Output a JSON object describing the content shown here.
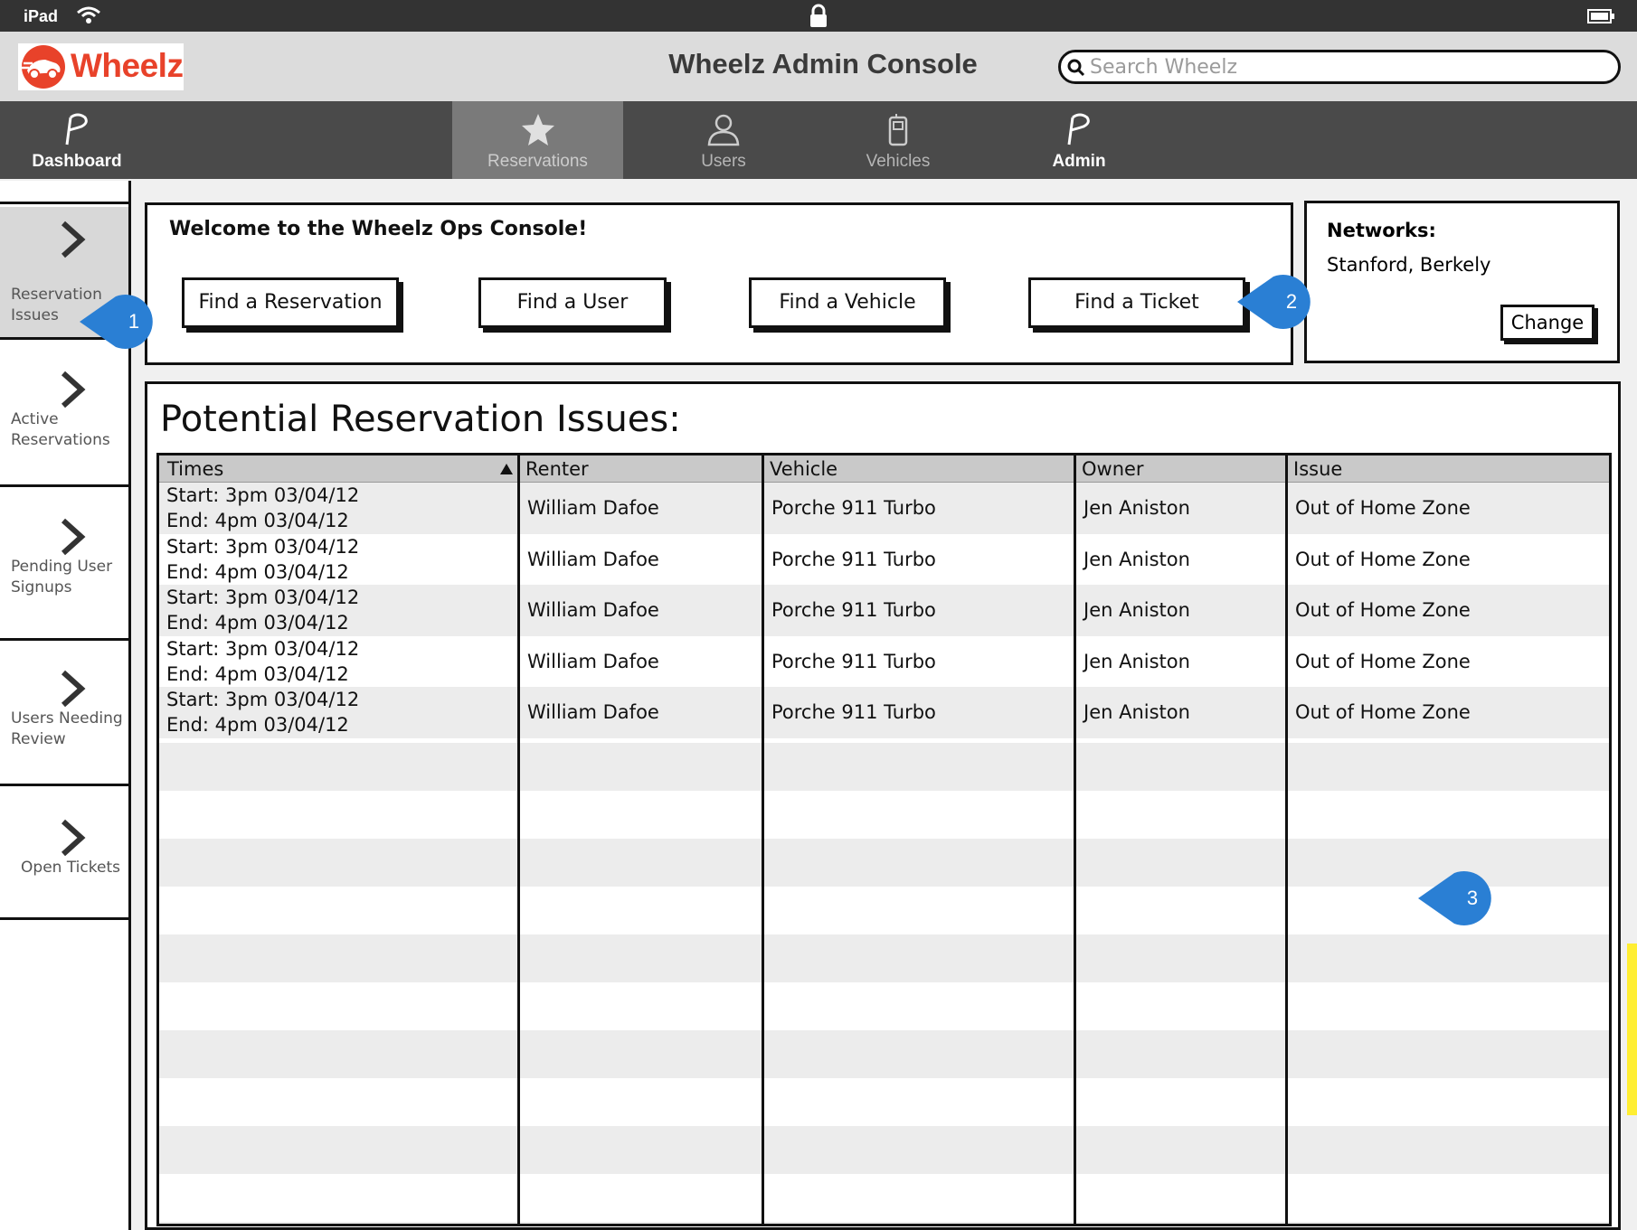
{
  "status_bar": {
    "device": "iPad"
  },
  "header": {
    "logo_text": "Wheelz",
    "title": "Wheelz Admin Console",
    "search_placeholder": "Search Wheelz"
  },
  "nav": {
    "items": [
      {
        "label": "Dashboard",
        "icon": "flag-icon"
      },
      {
        "label": "Reservations",
        "icon": "star-icon",
        "active": true
      },
      {
        "label": "Users",
        "icon": "user-icon"
      },
      {
        "label": "Vehicles",
        "icon": "phone-icon"
      },
      {
        "label": "Admin",
        "icon": "flag-icon"
      }
    ]
  },
  "sidebar": {
    "items": [
      {
        "line1": "Reservation",
        "line2": "Issues",
        "active": true
      },
      {
        "line1": "Active",
        "line2": "Reservations"
      },
      {
        "line1": "Pending User",
        "line2": "Signups"
      },
      {
        "line1": "Users Needing",
        "line2": "Review"
      },
      {
        "line1": "Open Tickets",
        "line2": ""
      }
    ]
  },
  "welcome": {
    "text": "Welcome to the Wheelz Ops Console!",
    "buttons": [
      "Find a Reservation",
      "Find a User",
      "Find a Vehicle",
      "Find a Ticket"
    ]
  },
  "networks": {
    "label": "Networks:",
    "value": "Stanford, Berkely",
    "change_label": "Change"
  },
  "issues": {
    "title": "Potential Reservation Issues:",
    "columns": [
      "Times",
      "Renter",
      "Vehicle",
      "Owner",
      "Issue"
    ],
    "rows": [
      {
        "start": "Start: 3pm 03/04/12",
        "end": "End: 4pm 03/04/12",
        "renter": "William Dafoe",
        "vehicle": "Porche 911 Turbo",
        "owner": "Jen Aniston",
        "issue": "Out of Home Zone"
      },
      {
        "start": "Start: 3pm 03/04/12",
        "end": "End: 4pm 03/04/12",
        "renter": "William Dafoe",
        "vehicle": "Porche 911 Turbo",
        "owner": "Jen Aniston",
        "issue": "Out of Home Zone"
      },
      {
        "start": "Start: 3pm 03/04/12",
        "end": "End: 4pm 03/04/12",
        "renter": "William Dafoe",
        "vehicle": "Porche 911 Turbo",
        "owner": "Jen Aniston",
        "issue": "Out of Home Zone"
      },
      {
        "start": "Start: 3pm 03/04/12",
        "end": "End: 4pm 03/04/12",
        "renter": "William Dafoe",
        "vehicle": "Porche 911 Turbo",
        "owner": "Jen Aniston",
        "issue": "Out of Home Zone"
      },
      {
        "start": "Start: 3pm 03/04/12",
        "end": "End: 4pm 03/04/12",
        "renter": "William Dafoe",
        "vehicle": "Porche 911 Turbo",
        "owner": "Jen Aniston",
        "issue": "Out of Home Zone"
      }
    ]
  },
  "callouts": [
    "1",
    "2",
    "3"
  ],
  "colors": {
    "brand": "#e8422a",
    "callout": "#2a7fd4",
    "nav_bg": "#4a4a4a",
    "status_bg": "#333333"
  }
}
